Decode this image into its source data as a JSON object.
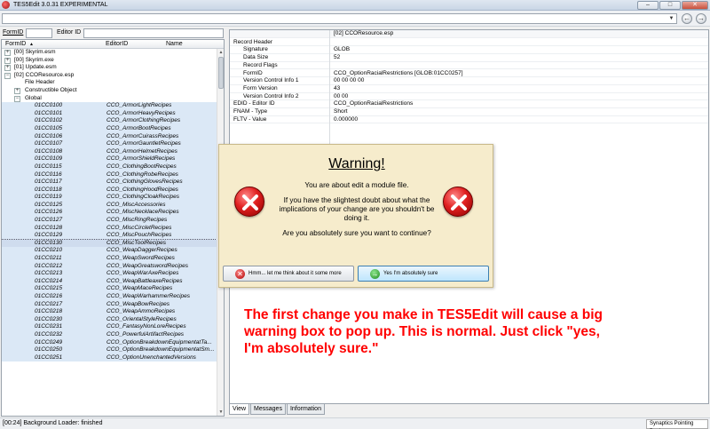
{
  "window": {
    "title": "TES5Edit 3.0.31 EXPERIMENTAL",
    "minimize": "–",
    "maximize": "□",
    "close": "✕"
  },
  "toolbar": {
    "path_value": "",
    "back_glyph": "←",
    "forward_glyph": "→"
  },
  "search": {
    "formid_label": "FormID",
    "editorid_label": "Editor ID",
    "formid_value": "",
    "editorid_value": ""
  },
  "tree": {
    "headers": {
      "formid": "FormID",
      "editorid": "EditorID",
      "name": "Name",
      "sort_glyph": "▲"
    },
    "plugins": [
      {
        "expander": "+",
        "label": "[00] Skyrim.esm"
      },
      {
        "expander": "+",
        "label": "[00] Skyrim.exe"
      },
      {
        "expander": "+",
        "label": "[01] Update.esm"
      },
      {
        "expander": "−",
        "label": "[02] CCOResource.esp"
      }
    ],
    "groups": [
      {
        "expander": "",
        "label": "File Header"
      },
      {
        "expander": "+",
        "label": "Constructible Object"
      },
      {
        "expander": "−",
        "label": "Global"
      }
    ],
    "records": [
      {
        "formid": "01CC0100",
        "editorid": "CCO_ArmorLightRecipes"
      },
      {
        "formid": "01CC0101",
        "editorid": "CCO_ArmorHeavyRecipes"
      },
      {
        "formid": "01CC0102",
        "editorid": "CCO_ArmorClothingRecipes"
      },
      {
        "formid": "01CC0105",
        "editorid": "CCO_ArmorBootRecipes"
      },
      {
        "formid": "01CC0106",
        "editorid": "CCO_ArmorCuirassRecipes"
      },
      {
        "formid": "01CC0107",
        "editorid": "CCO_ArmorGauntletRecipes"
      },
      {
        "formid": "01CC0108",
        "editorid": "CCO_ArmorHelmetRecipes"
      },
      {
        "formid": "01CC0109",
        "editorid": "CCO_ArmorShieldRecipes"
      },
      {
        "formid": "01CC0115",
        "editorid": "CCO_ClothingBootRecipes"
      },
      {
        "formid": "01CC0116",
        "editorid": "CCO_ClothingRobeRecipes"
      },
      {
        "formid": "01CC0117",
        "editorid": "CCO_ClothingGlovesRecipes"
      },
      {
        "formid": "01CC0118",
        "editorid": "CCO_ClothingHoodRecipes"
      },
      {
        "formid": "01CC0119",
        "editorid": "CCO_ClothingCloakRecipes"
      },
      {
        "formid": "01CC0125",
        "editorid": "CCO_MiscAccessories"
      },
      {
        "formid": "01CC0126",
        "editorid": "CCO_MiscNecklaceRecipes"
      },
      {
        "formid": "01CC0127",
        "editorid": "CCO_MiscRingRecipes"
      },
      {
        "formid": "01CC0128",
        "editorid": "CCO_MiscCircletRecipes"
      },
      {
        "formid": "01CC0129",
        "editorid": "CCO_MiscPouchRecipes"
      },
      {
        "formid": "01CC0130",
        "editorid": "CCO_MiscToolRecipes"
      },
      {
        "formid": "01CC0210",
        "editorid": "CCO_WeapDaggerRecipes"
      },
      {
        "formid": "01CC0211",
        "editorid": "CCO_WeapSwordRecipes"
      },
      {
        "formid": "01CC0212",
        "editorid": "CCO_WeapGreatswordRecipes"
      },
      {
        "formid": "01CC0213",
        "editorid": "CCO_WeapWarAxeRecipes"
      },
      {
        "formid": "01CC0214",
        "editorid": "CCO_WeapBattleaxeRecipes"
      },
      {
        "formid": "01CC0215",
        "editorid": "CCO_WeapMaceRecipes"
      },
      {
        "formid": "01CC0216",
        "editorid": "CCO_WeapWarhammerRecipes"
      },
      {
        "formid": "01CC0217",
        "editorid": "CCO_WeapBowRecipes"
      },
      {
        "formid": "01CC0218",
        "editorid": "CCO_WeapAmmoRecipes"
      },
      {
        "formid": "01CC0230",
        "editorid": "CCO_OrientalStyleRecipes"
      },
      {
        "formid": "01CC0231",
        "editorid": "CCO_FantasyNonLoreRecipes"
      },
      {
        "formid": "01CC0232",
        "editorid": "CCO_PowerfulArtifactRecipes"
      },
      {
        "formid": "01CC0249",
        "editorid": "CCO_OptionBreakdownEquipmentatTa..."
      },
      {
        "formid": "01CC0250",
        "editorid": "CCO_OptionBreakdownEquipmentatSm..."
      },
      {
        "formid": "01CC0251",
        "editorid": "CCO_OptionUnenchantedVersions"
      }
    ],
    "selected_index": 18
  },
  "record_view": {
    "column_header": "[02] CCOResource.esp",
    "rows": [
      {
        "key": "Record Header",
        "value": "",
        "indent": 0
      },
      {
        "key": "Signature",
        "value": "GLOB",
        "indent": 1
      },
      {
        "key": "Data Size",
        "value": "52",
        "indent": 1
      },
      {
        "key": "Record Flags",
        "value": "",
        "indent": 1
      },
      {
        "key": "FormID",
        "value": "CCO_OptionRacialRestrictions [GLOB:01CC0257]",
        "indent": 1
      },
      {
        "key": "Version Control Info 1",
        "value": "00 00 00 00",
        "indent": 1
      },
      {
        "key": "Form Version",
        "value": "43",
        "indent": 1
      },
      {
        "key": "Version Control Info 2",
        "value": "00 00",
        "indent": 1
      },
      {
        "key": "EDID - Editor ID",
        "value": "CCO_OptionRacialRestrictions",
        "indent": 0
      },
      {
        "key": "FNAM - Type",
        "value": "Short",
        "indent": 0
      },
      {
        "key": "FLTV - Value",
        "value": "0.000000",
        "indent": 0
      }
    ]
  },
  "tabs": [
    "View",
    "Messages",
    "Information"
  ],
  "status": {
    "text": "[00:24] Background Loader: finished",
    "tray": "Synaptics Pointing Device"
  },
  "dialog": {
    "title": "Warning!",
    "line1": "You are about edit a module file.",
    "line2": "If you have the slightest doubt about what the implications of your change are you shouldn't be doing it.",
    "line3": "Are you absolutely sure you want to continue?",
    "no_label": "Hmm... let me think about it some more",
    "yes_label": "Yes I'm absolutely sure",
    "no_glyph": "✕",
    "yes_glyph": "→",
    "icon": "error-x-icon",
    "background": "#f6eccc"
  },
  "annotation": {
    "text": "The first change you make in TES5Edit will cause a big warning box to pop up.  This is normal. Just click \"yes, I'm absolutely sure.\"",
    "color": "#ff0000"
  }
}
